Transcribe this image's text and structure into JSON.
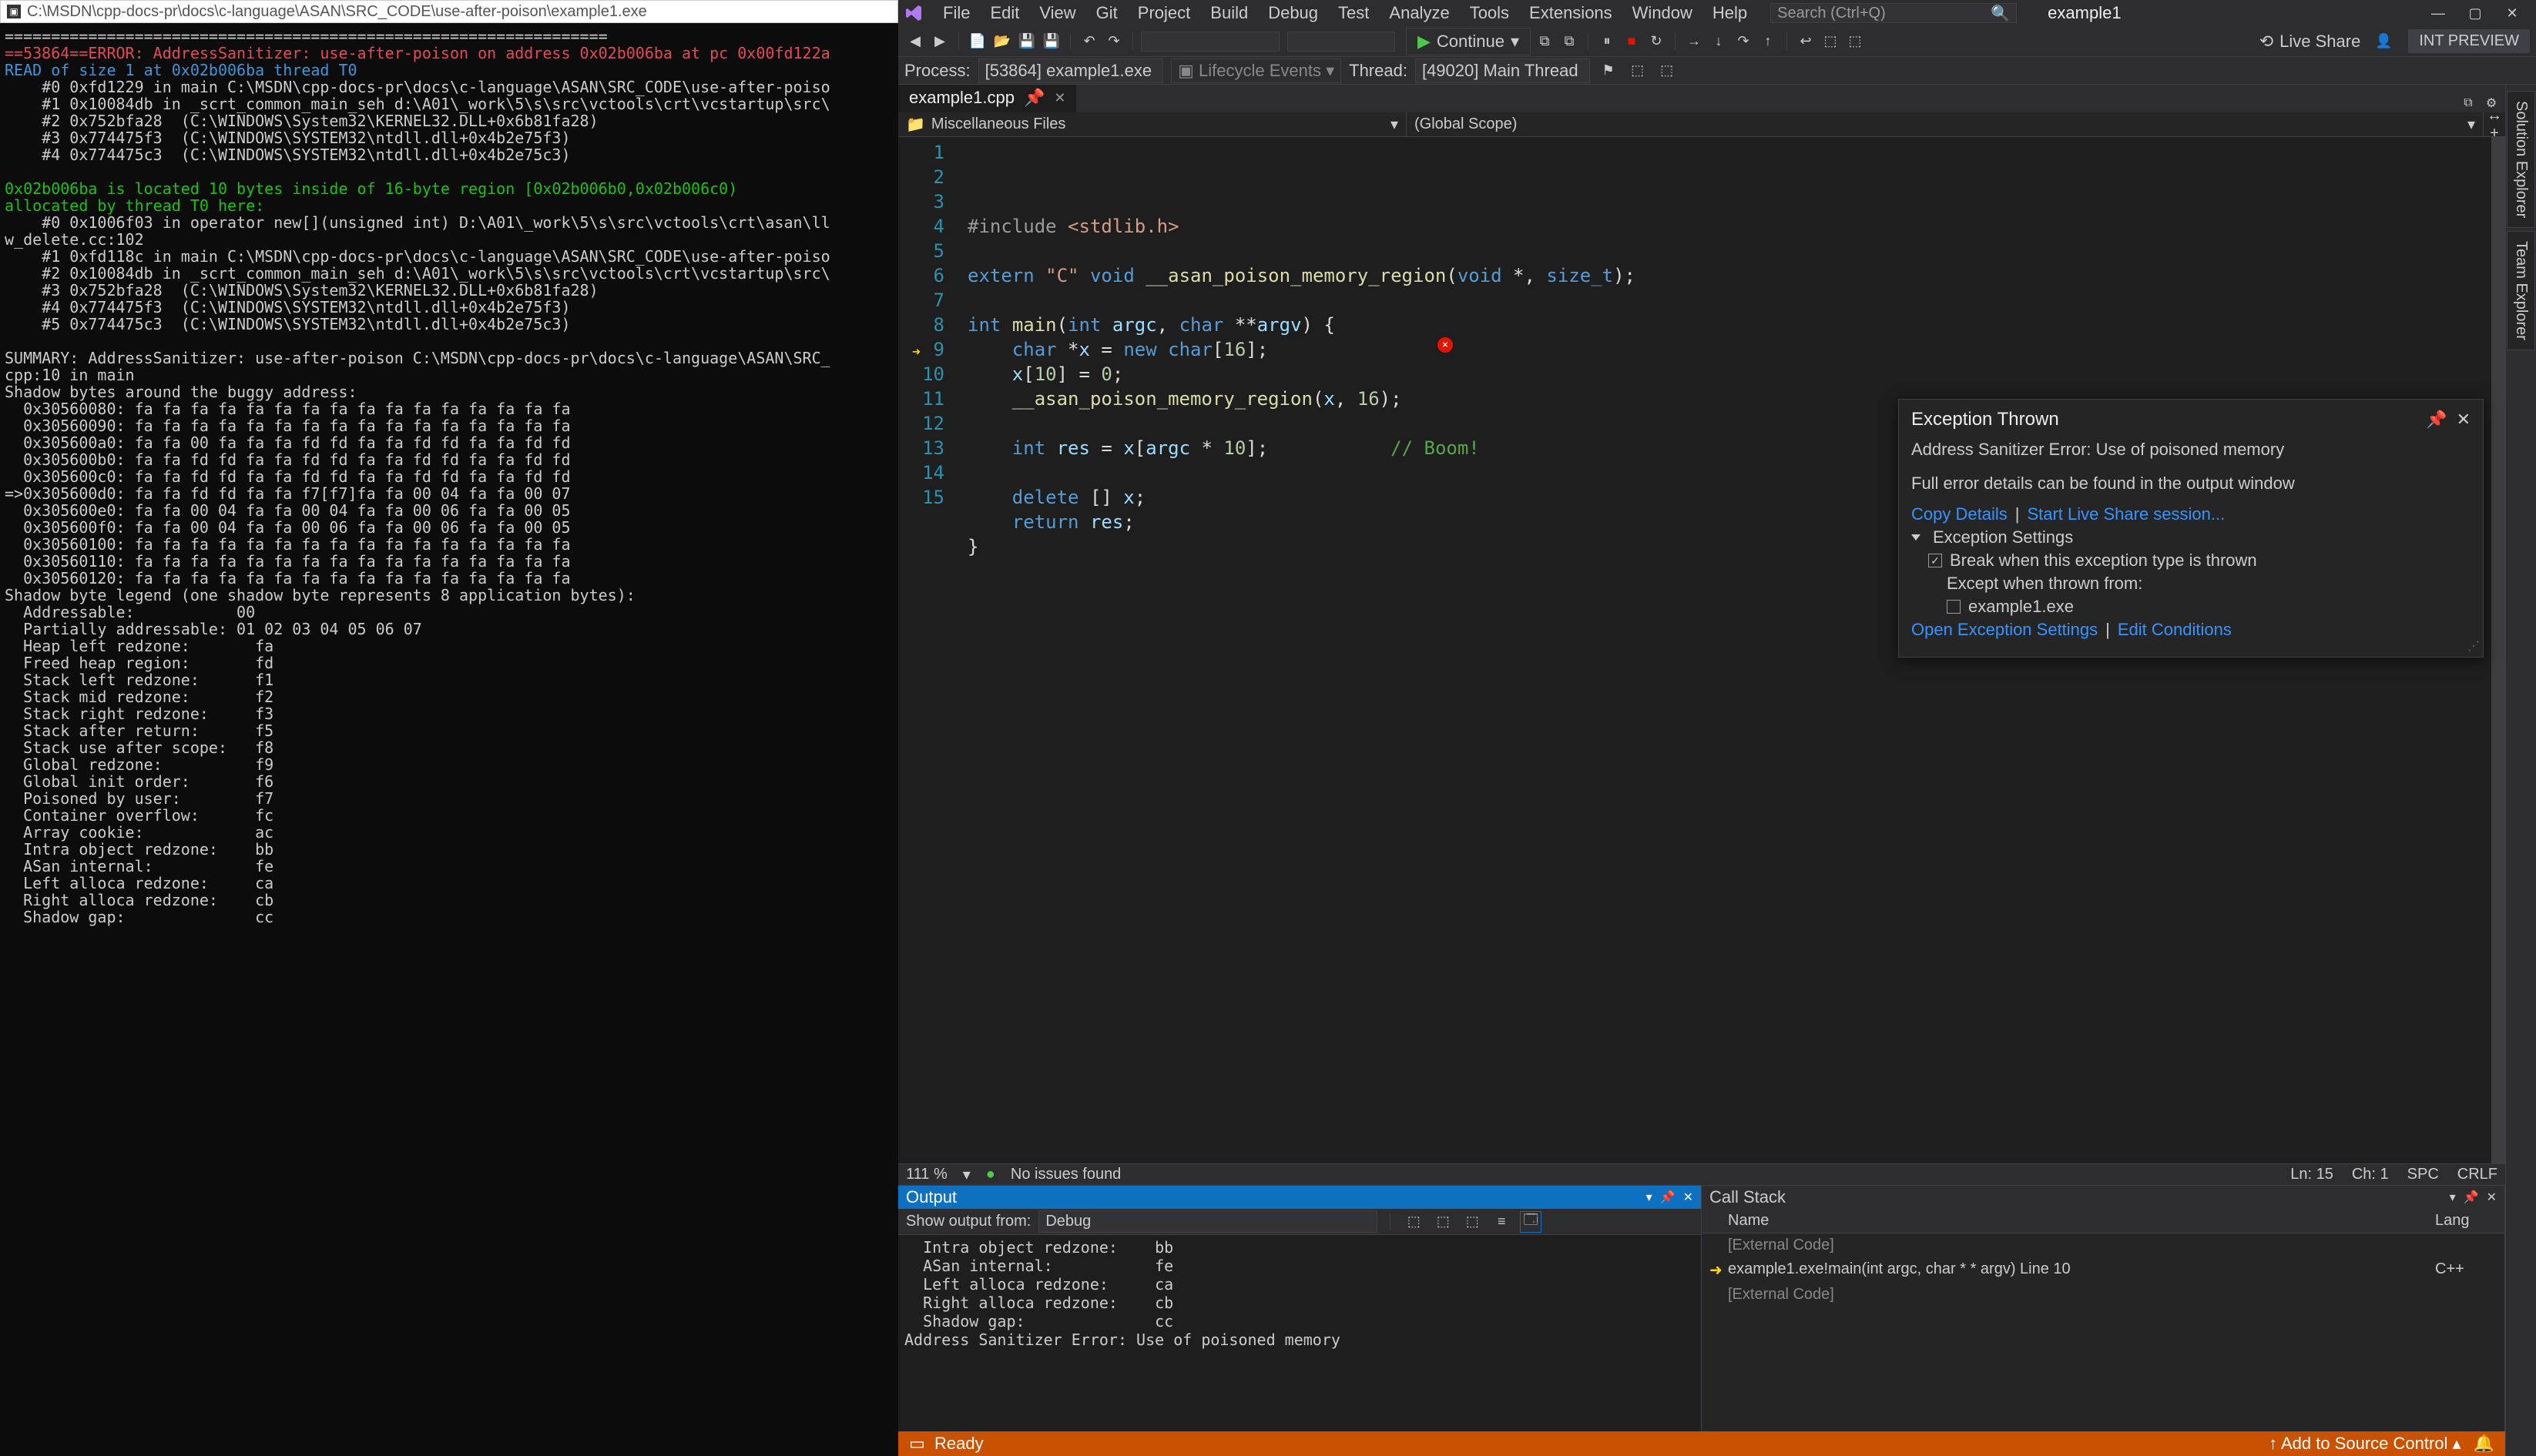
{
  "console": {
    "title": "C:\\MSDN\\cpp-docs-pr\\docs\\c-language\\ASAN\\SRC_CODE\\use-after-poison\\example1.exe",
    "body": "=================================================================\n<RED>==53864==ERROR: AddressSanitizer: use-after-poison on address 0x02b006ba at pc 0x00fd122a</RED>\n<BLU>READ of size 1 at 0x02b006ba thread T0</BLU>\n    #0 0xfd1229 in main C:\\MSDN\\cpp-docs-pr\\docs\\c-language\\ASAN\\SRC_CODE\\use-after-poiso\n    #1 0x10084db in _scrt_common_main_seh d:\\A01\\_work\\5\\s\\src\\vctools\\crt\\vcstartup\\src\\\n    #2 0x752bfa28  (C:\\WINDOWS\\System32\\KERNEL32.DLL+0x6b81fa28)\n    #3 0x774475f3  (C:\\WINDOWS\\SYSTEM32\\ntdll.dll+0x4b2e75f3)\n    #4 0x774475c3  (C:\\WINDOWS\\SYSTEM32\\ntdll.dll+0x4b2e75c3)\n\n<GRN>0x02b006ba is located 10 bytes inside of 16-byte region [0x02b006b0,0x02b006c0)</GRN>\n<GRN>allocated by thread T0 here:</GRN>\n    #0 0x1006f03 in operator new[](unsigned int) D:\\A01\\_work\\5\\s\\src\\vctools\\crt\\asan\\ll\nw_delete.cc:102\n    #1 0xfd118c in main C:\\MSDN\\cpp-docs-pr\\docs\\c-language\\ASAN\\SRC_CODE\\use-after-poiso\n    #2 0x10084db in _scrt_common_main_seh d:\\A01\\_work\\5\\s\\src\\vctools\\crt\\vcstartup\\src\\\n    #3 0x752bfa28  (C:\\WINDOWS\\System32\\KERNEL32.DLL+0x6b81fa28)\n    #4 0x774475f3  (C:\\WINDOWS\\SYSTEM32\\ntdll.dll+0x4b2e75f3)\n    #5 0x774475c3  (C:\\WINDOWS\\SYSTEM32\\ntdll.dll+0x4b2e75c3)\n\nSUMMARY: AddressSanitizer: use-after-poison C:\\MSDN\\cpp-docs-pr\\docs\\c-language\\ASAN\\SRC_\ncpp:10 in main\nShadow bytes around the buggy address:\n  0x30560080: fa fa fa fa fa fa fa fa fa fa fa fa fa fa fa fa\n  0x30560090: fa fa fa fa fa fa fa fa fa fa fa fa fa fa fa fa\n  0x305600a0: fa fa 00 fa fa fa fd fd fa fa fd fd fa fa fd fd\n  0x305600b0: fa fa fd fd fa fa fd fd fa fa fd fd fa fa fd fd\n  0x305600c0: fa fa fd fd fa fa fd fd fa fa fd fd fa fa fd fd\n=>0x305600d0: fa fa fd fd fa fa f7[f7]fa fa 00 04 fa fa 00 07\n  0x305600e0: fa fa 00 04 fa fa 00 04 fa fa 00 06 fa fa 00 05\n  0x305600f0: fa fa 00 04 fa fa 00 06 fa fa 00 06 fa fa 00 05\n  0x30560100: fa fa fa fa fa fa fa fa fa fa fa fa fa fa fa fa\n  0x30560110: fa fa fa fa fa fa fa fa fa fa fa fa fa fa fa fa\n  0x30560120: fa fa fa fa fa fa fa fa fa fa fa fa fa fa fa fa\nShadow byte legend (one shadow byte represents 8 application bytes):\n  Addressable:           00\n  Partially addressable: 01 02 03 04 05 06 07\n  Heap left redzone:       fa\n  Freed heap region:       fd\n  Stack left redzone:      f1\n  Stack mid redzone:       f2\n  Stack right redzone:     f3\n  Stack after return:      f5\n  Stack use after scope:   f8\n  Global redzone:          f9\n  Global init order:       f6\n  Poisoned by user:        f7\n  Container overflow:      fc\n  Array cookie:            ac\n  Intra object redzone:    bb\n  ASan internal:           fe\n  Left alloca redzone:     ca\n  Right alloca redzone:    cb\n  Shadow gap:              cc"
  },
  "vs": {
    "menu": [
      "File",
      "Edit",
      "View",
      "Git",
      "Project",
      "Build",
      "Debug",
      "Test",
      "Analyze",
      "Tools",
      "Extensions",
      "Window",
      "Help"
    ],
    "search_placeholder": "Search (Ctrl+Q)",
    "solution": "example1",
    "continue": "Continue",
    "liveshare": "Live Share",
    "intpreview": "INT PREVIEW",
    "process_lbl": "Process:",
    "process_val": "[53864] example1.exe",
    "lifecycle": "Lifecycle Events",
    "thread_lbl": "Thread:",
    "thread_val": "[49020] Main Thread",
    "doc_tab": "example1.cpp",
    "bc1": "Miscellaneous Files",
    "bc2": "(Global Scope)",
    "sidetabs": [
      "Solution Explorer",
      "Team Explorer"
    ],
    "code_lines": [
      {
        "n": 1,
        "html": "<span class='tok-pp'>#include</span> <span class='tok-str'>&lt;stdlib.h&gt;</span>"
      },
      {
        "n": 2,
        "html": ""
      },
      {
        "n": 3,
        "html": "<span class='tok-kw'>extern</span> <span class='tok-str'>\"C\"</span> <span class='tok-kw'>void</span> <span class='tok-fn'>__asan_poison_memory_region</span>(<span class='tok-kw'>void</span> *, <span class='tok-type'>size_t</span>);"
      },
      {
        "n": 4,
        "html": ""
      },
      {
        "n": 5,
        "html": "<span class='tok-kw'>int</span> <span class='tok-fn'>main</span>(<span class='tok-kw'>int</span> <span class='tok-var'>argc</span>, <span class='tok-kw'>char</span> **<span class='tok-var'>argv</span>) {"
      },
      {
        "n": 6,
        "html": "    <span class='tok-kw'>char</span> *<span class='tok-var'>x</span> = <span class='tok-kw'>new</span> <span class='tok-kw'>char</span>[<span class='tok-num'>16</span>];"
      },
      {
        "n": 7,
        "html": "    <span class='tok-var'>x</span>[<span class='tok-num'>10</span>] = <span class='tok-num'>0</span>;"
      },
      {
        "n": 8,
        "html": "    <span class='tok-fn'>__asan_poison_memory_region</span>(<span class='tok-var'>x</span>, <span class='tok-num'>16</span>);"
      },
      {
        "n": 9,
        "html": ""
      },
      {
        "n": 10,
        "html": "    <span class='tok-kw'>int</span> <span class='tok-var'>res</span> = <span class='tok-var'>x</span>[<span class='tok-var'>argc</span> * <span class='tok-num'>10</span>];           <span class='tok-cm'>// Boom!</span>"
      },
      {
        "n": 11,
        "html": ""
      },
      {
        "n": 12,
        "html": "    <span class='tok-kw'>delete</span> [] <span class='tok-var'>x</span>;"
      },
      {
        "n": 13,
        "html": "    <span class='tok-kw'>return</span> <span class='tok-var'>res</span>;"
      },
      {
        "n": 14,
        "html": "}"
      },
      {
        "n": 15,
        "html": ""
      }
    ],
    "exc": {
      "title": "Exception Thrown",
      "msg": "Address Sanitizer Error: Use of poisoned memory",
      "sub": "Full error details can be found in the output window",
      "copy": "Copy Details",
      "start_ls": "Start Live Share session...",
      "settings": "Exception Settings",
      "break": "Break when this exception type is thrown",
      "except": "Except when thrown from:",
      "exe": "example1.exe",
      "open": "Open Exception Settings",
      "edit": "Edit Conditions"
    },
    "ed_status": {
      "zoom": "111 %",
      "issues": "No issues found",
      "ln": "Ln: 15",
      "ch": "Ch: 1",
      "spc": "SPC",
      "crlf": "CRLF"
    },
    "output": {
      "title": "Output",
      "show_from": "Show output from:",
      "source": "Debug",
      "body": "  Intra object redzone:    bb\n  ASan internal:           fe\n  Left alloca redzone:     ca\n  Right alloca redzone:    cb\n  Shadow gap:              cc\nAddress Sanitizer Error: Use of poisoned memory\n"
    },
    "stack": {
      "title": "Call Stack",
      "col1": "Name",
      "col2": "Lang",
      "rows": [
        {
          "dim": true,
          "txt": "[External Code]",
          "lang": ""
        },
        {
          "dim": false,
          "txt": "example1.exe!main(int argc, char * * argv) Line 10",
          "lang": "C++",
          "cur": true
        },
        {
          "dim": true,
          "txt": "[External Code]",
          "lang": ""
        }
      ]
    },
    "status": {
      "ready": "Ready",
      "add_src": "Add to Source Control"
    }
  }
}
